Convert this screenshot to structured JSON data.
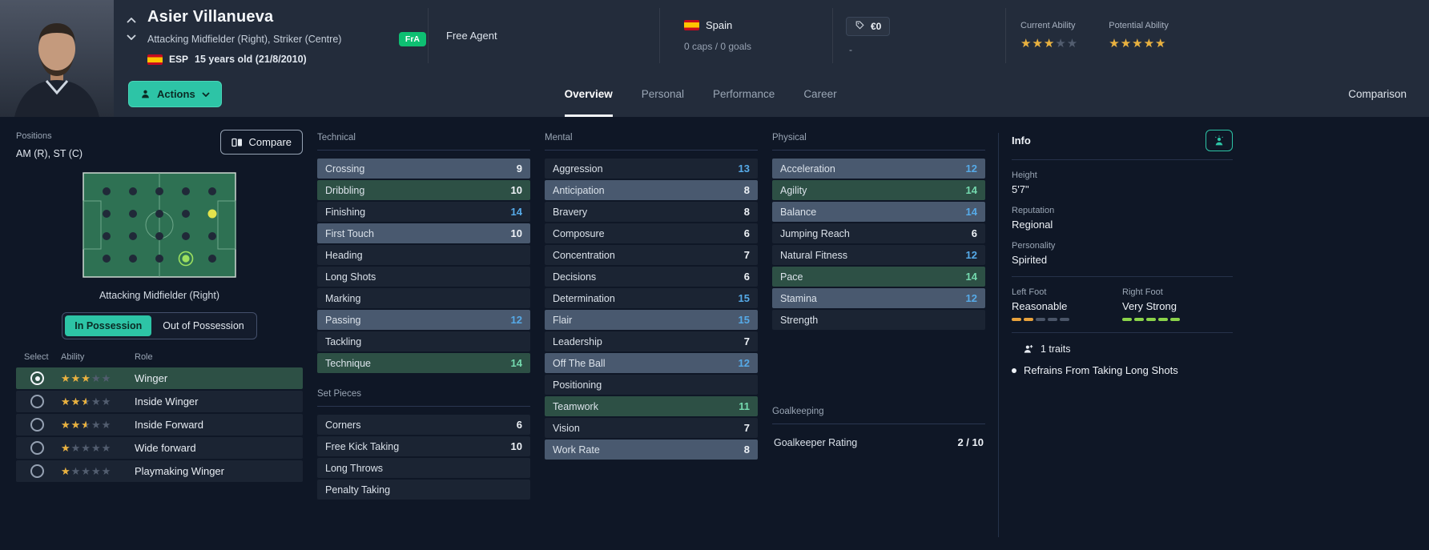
{
  "header": {
    "name": "Asier Villanueva",
    "positions": "Attacking Midfielder (Right), Striker (Centre)",
    "badge": "FrA",
    "nationality_code": "ESP",
    "age": "15 years old (21/8/2010)",
    "club": "Free Agent",
    "nation": "Spain",
    "caps": "0 caps / 0 goals",
    "value": "€0",
    "value_sub": "-",
    "current_ability_label": "Current Ability",
    "potential_ability_label": "Potential Ability",
    "current_ability_stars": 3,
    "potential_ability_stars": 5,
    "actions_label": "Actions"
  },
  "tabs": [
    {
      "label": "Overview",
      "active": true
    },
    {
      "label": "Personal",
      "active": false
    },
    {
      "label": "Performance",
      "active": false
    },
    {
      "label": "Career",
      "active": false
    }
  ],
  "comparison_tab": "Comparison",
  "positions_panel": {
    "title": "Positions",
    "positions_text": "AM (R), ST (C)",
    "compare_label": "Compare",
    "pitch_caption": "Attacking Midfielder (Right)",
    "toggle": [
      "In Possession",
      "Out of Possession"
    ],
    "toggle_active": 0,
    "table_headers": [
      "Select",
      "Ability",
      "Role"
    ],
    "roles": [
      {
        "name": "Winger",
        "stars": 3,
        "selected": true
      },
      {
        "name": "Inside Winger",
        "stars": 2.5,
        "selected": false
      },
      {
        "name": "Inside Forward",
        "stars": 2.5,
        "selected": false
      },
      {
        "name": "Wide forward",
        "stars": 1,
        "selected": false
      },
      {
        "name": "Playmaking Winger",
        "stars": 1,
        "selected": false
      }
    ]
  },
  "attributes": {
    "technical": {
      "title": "Technical",
      "rows": [
        {
          "name": "Crossing",
          "value": 9,
          "hl": "slate"
        },
        {
          "name": "Dribbling",
          "value": 10,
          "hl": "green"
        },
        {
          "name": "Finishing",
          "value": 14,
          "hl": "none"
        },
        {
          "name": "First Touch",
          "value": 10,
          "hl": "slate"
        },
        {
          "name": "Heading",
          "value": null,
          "hl": "none"
        },
        {
          "name": "Long Shots",
          "value": null,
          "hl": "none"
        },
        {
          "name": "Marking",
          "value": null,
          "hl": "none"
        },
        {
          "name": "Passing",
          "value": 12,
          "hl": "slate"
        },
        {
          "name": "Tackling",
          "value": null,
          "hl": "none"
        },
        {
          "name": "Technique",
          "value": 14,
          "hl": "green"
        }
      ]
    },
    "set_pieces": {
      "title": "Set Pieces",
      "rows": [
        {
          "name": "Corners",
          "value": 6,
          "hl": "none"
        },
        {
          "name": "Free Kick Taking",
          "value": 10,
          "hl": "none"
        },
        {
          "name": "Long Throws",
          "value": null,
          "hl": "none"
        },
        {
          "name": "Penalty Taking",
          "value": null,
          "hl": "none"
        }
      ]
    },
    "mental": {
      "title": "Mental",
      "rows": [
        {
          "name": "Aggression",
          "value": 13,
          "hl": "none"
        },
        {
          "name": "Anticipation",
          "value": 8,
          "hl": "slate"
        },
        {
          "name": "Bravery",
          "value": 8,
          "hl": "none"
        },
        {
          "name": "Composure",
          "value": 6,
          "hl": "none"
        },
        {
          "name": "Concentration",
          "value": 7,
          "hl": "none"
        },
        {
          "name": "Decisions",
          "value": 6,
          "hl": "none"
        },
        {
          "name": "Determination",
          "value": 15,
          "hl": "none"
        },
        {
          "name": "Flair",
          "value": 15,
          "hl": "slate"
        },
        {
          "name": "Leadership",
          "value": 7,
          "hl": "none"
        },
        {
          "name": "Off The Ball",
          "value": 12,
          "hl": "slate"
        },
        {
          "name": "Positioning",
          "value": null,
          "hl": "none"
        },
        {
          "name": "Teamwork",
          "value": 11,
          "hl": "green"
        },
        {
          "name": "Vision",
          "value": 7,
          "hl": "none"
        },
        {
          "name": "Work Rate",
          "value": 8,
          "hl": "slate"
        }
      ]
    },
    "physical": {
      "title": "Physical",
      "rows": [
        {
          "name": "Acceleration",
          "value": 12,
          "hl": "slate"
        },
        {
          "name": "Agility",
          "value": 14,
          "hl": "green"
        },
        {
          "name": "Balance",
          "value": 14,
          "hl": "slate"
        },
        {
          "name": "Jumping Reach",
          "value": 6,
          "hl": "none"
        },
        {
          "name": "Natural Fitness",
          "value": 12,
          "hl": "none"
        },
        {
          "name": "Pace",
          "value": 14,
          "hl": "green"
        },
        {
          "name": "Stamina",
          "value": 12,
          "hl": "slate"
        },
        {
          "name": "Strength",
          "value": null,
          "hl": "none"
        }
      ]
    },
    "goalkeeping": {
      "title": "Goalkeeping",
      "rows": [
        {
          "name": "Goalkeeper Rating",
          "value": "2 / 10",
          "hl": "plain"
        }
      ]
    }
  },
  "info": {
    "title": "Info",
    "height_label": "Height",
    "height": "5'7\"",
    "reputation_label": "Reputation",
    "reputation": "Regional",
    "personality_label": "Personality",
    "personality": "Spirited",
    "left_foot_label": "Left Foot",
    "left_foot": "Reasonable",
    "left_foot_level": 2,
    "right_foot_label": "Right Foot",
    "right_foot": "Very Strong",
    "right_foot_level": 5,
    "traits_count": "1 traits",
    "traits": [
      "Refrains From Taking Long Shots"
    ]
  },
  "colors": {
    "accent_teal": "#2dc4a6",
    "star_gold": "#e9b13e",
    "value_blue": "#56aae8",
    "value_teal": "#74d9ae",
    "row_green": "#2d5045",
    "row_slate": "#49596f",
    "left_foot_bar": "#e8a23c",
    "right_foot_bar": "#8bd34a",
    "badge_green": "#0ebf72"
  }
}
